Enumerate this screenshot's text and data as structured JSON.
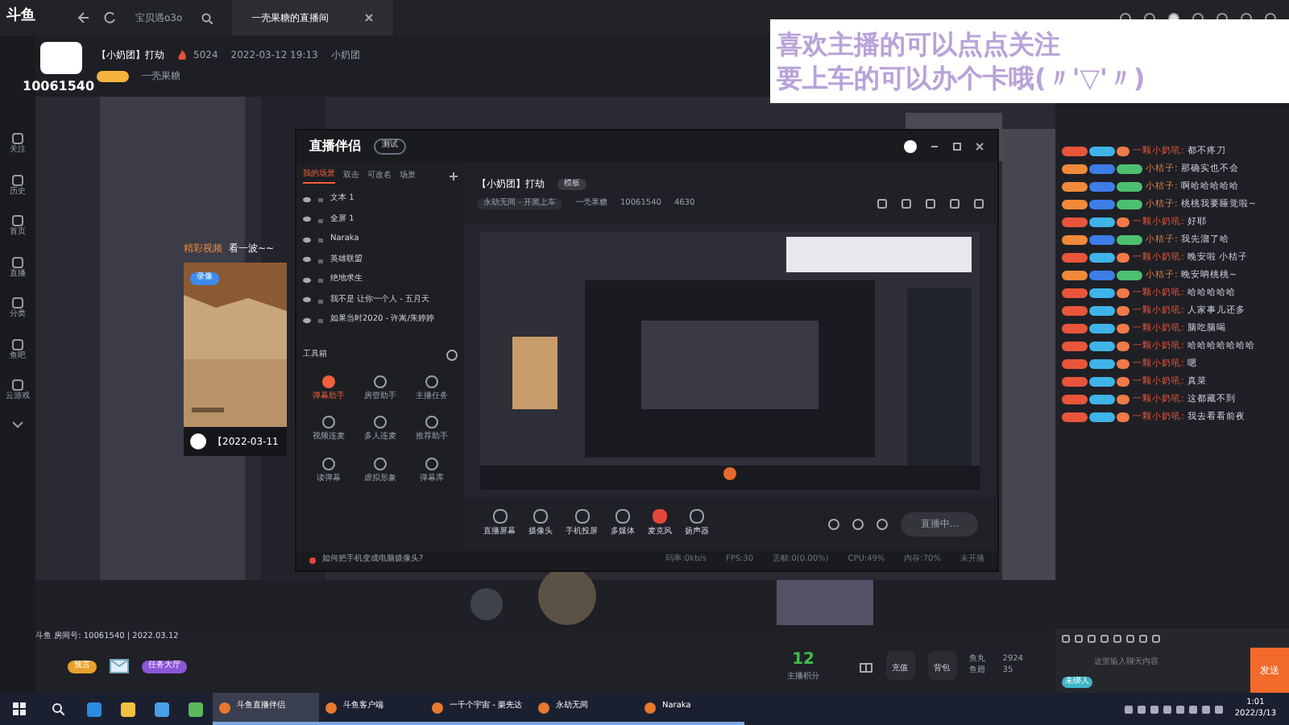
{
  "top_bar": {
    "logo": "斗鱼",
    "tabs": [
      {
        "label": "宝贝遇o3o",
        "selected": false
      },
      {
        "label": "一壳果糖的直播间",
        "selected": true
      }
    ]
  },
  "sidebar": {
    "items": [
      {
        "label": "关注"
      },
      {
        "label": "历史"
      },
      {
        "label": "首页"
      },
      {
        "label": "直播"
      },
      {
        "label": "分类"
      },
      {
        "label": "鱼吧"
      },
      {
        "label": "云游戏"
      }
    ]
  },
  "room": {
    "title": "【小奶团】打劫",
    "heat": "5024",
    "time": "2022-03-12 19:13",
    "category": "小奶团",
    "streamer": "一壳果糖",
    "room_number": "10061540"
  },
  "overlay_notice": {
    "lines": [
      "喜欢主播的可以点点关注",
      "要上车的可以办个卡哦(〃'▽'〃)"
    ]
  },
  "video_card": {
    "heading": "精彩视频",
    "subheading": "看一波~~",
    "badge": "录像",
    "caption": "【2022-03-11"
  },
  "companion": {
    "logo": "直播伴侣",
    "badge": "测试",
    "scene_tabs": [
      {
        "label": "我的场景",
        "selected": true
      },
      {
        "label": "双击",
        "selected": false
      },
      {
        "label": "可改名",
        "selected": false
      },
      {
        "label": "场景",
        "selected": false
      }
    ],
    "sources": [
      "文本 1",
      "全屏 1",
      "Naraka",
      "英雄联盟",
      "绝地求生",
      "我不是 让你一个人 - 五月天",
      "如果当时2020 - 许嵩/朱婷婷"
    ],
    "tools_title": "工具箱",
    "tools": [
      {
        "label": "弹幕助手",
        "selected": true
      },
      {
        "label": "房管助手",
        "selected": false
      },
      {
        "label": "主播任务",
        "selected": false
      },
      {
        "label": "视频连麦",
        "selected": false
      },
      {
        "label": "多人连麦",
        "selected": false
      },
      {
        "label": "推荐助手",
        "selected": false
      },
      {
        "label": "读弹幕",
        "selected": false
      },
      {
        "label": "虚拟形象",
        "selected": false
      },
      {
        "label": "弹幕库",
        "selected": false
      }
    ],
    "stream_title": "【小奶团】打劫",
    "template": "模板",
    "game": "永劫无间 - 开黑上车",
    "streamer": "一壳果糖",
    "room_number": "10061540",
    "heat": "4630",
    "controls": [
      {
        "label": "直播屏幕",
        "selected": false
      },
      {
        "label": "摄像头",
        "selected": false
      },
      {
        "label": "手机投屏",
        "selected": false
      },
      {
        "label": "多媒体",
        "selected": false
      },
      {
        "label": "麦克风",
        "selected": true
      },
      {
        "label": "扬声器",
        "selected": false
      }
    ],
    "live_button": "直播中...",
    "tip": "如何把手机变成电脑摄像头?",
    "status": [
      "码率:0kb/s",
      "FPS:30",
      "丢帧:0(0.00%)",
      "CPU:49%",
      "内存:70%",
      "未开播"
    ]
  },
  "chat": {
    "messages": [
      {
        "user": "一颗小奶吼:",
        "text": "都不疼刀",
        "kind": "fan"
      },
      {
        "user": "小桔子:",
        "text": "那确实也不会",
        "kind": "guest"
      },
      {
        "user": "小桔子:",
        "text": "啊哈哈哈哈哈",
        "kind": "guest"
      },
      {
        "user": "小桔子:",
        "text": "桃桃我要睡觉啦~",
        "kind": "guest"
      },
      {
        "user": "一颗小奶吼:",
        "text": "好耶",
        "kind": "fan"
      },
      {
        "user": "小桔子:",
        "text": "我先溜了哈",
        "kind": "guest"
      },
      {
        "user": "一颗小奶吼:",
        "text": "晚安啦 小桔子",
        "kind": "fan"
      },
      {
        "user": "小桔子:",
        "text": "晚安呐桃桃~",
        "kind": "guest"
      },
      {
        "user": "一颗小奶吼:",
        "text": "哈哈哈哈哈",
        "kind": "fan"
      },
      {
        "user": "一颗小奶吼:",
        "text": "人家事儿还多",
        "kind": "fan"
      },
      {
        "user": "一颗小奶吼:",
        "text": "脑吃脑喝",
        "kind": "fan"
      },
      {
        "user": "一颗小奶吼:",
        "text": "哈哈哈哈哈哈哈",
        "kind": "fan"
      },
      {
        "user": "一颗小奶吼:",
        "text": "嗯",
        "kind": "fan"
      },
      {
        "user": "一颗小奶吼:",
        "text": "真菜",
        "kind": "fan"
      },
      {
        "user": "一颗小奶吼:",
        "text": "这都藏不到",
        "kind": "fan"
      },
      {
        "user": "一颗小奶吼:",
        "text": "我去看看前夜",
        "kind": "fan"
      }
    ],
    "placeholder": "这里输入聊天内容",
    "send": "发送",
    "guest_tag": "未绑人"
  },
  "footer": {
    "info": "斗鱼 房间号: 10061540 | 2022.03.12",
    "badges": [
      "预言",
      "任务大厅"
    ],
    "score": "12",
    "score_label": "主播积分",
    "recharge": "充值",
    "bag": "背包",
    "fish_ball_label": "鱼丸",
    "fish_ball": "2924",
    "fish_fin_label": "鱼翅",
    "fish_fin": "35"
  },
  "taskbar": {
    "apps": [
      {
        "label": "斗鱼直播伴侣",
        "selected": true
      },
      {
        "label": "斗鱼客户端",
        "selected": false
      },
      {
        "label": "一千个宇宙 - 栗先达",
        "selected": false
      },
      {
        "label": "永劫无间",
        "selected": false
      },
      {
        "label": "Naraka",
        "selected": false
      }
    ],
    "time": "1:01",
    "date": "2022/3/13"
  }
}
